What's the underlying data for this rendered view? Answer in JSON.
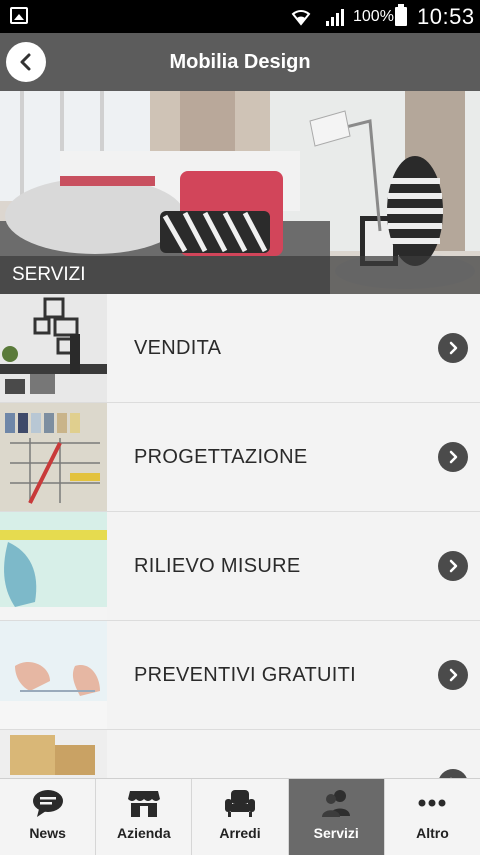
{
  "status_bar": {
    "battery": "100%",
    "time": "10:53"
  },
  "header": {
    "title": "Mobilia Design"
  },
  "hero": {
    "caption": "SERVIZI"
  },
  "services": [
    {
      "label": "VENDITA"
    },
    {
      "label": "PROGETTAZIONE"
    },
    {
      "label": "RILIEVO MISURE"
    },
    {
      "label": "PREVENTIVI GRATUITI"
    },
    {
      "label": ""
    }
  ],
  "tabs": [
    {
      "label": "News",
      "icon": "chat-bubble-icon"
    },
    {
      "label": "Azienda",
      "icon": "storefront-icon"
    },
    {
      "label": "Arredi",
      "icon": "armchair-icon"
    },
    {
      "label": "Servizi",
      "icon": "people-icon",
      "active": true
    },
    {
      "label": "Altro",
      "icon": "more-dots-icon"
    }
  ],
  "colors": {
    "header_bg": "#5c5c5c",
    "active_tab_bg": "#6a6a6a",
    "chevron_bg": "#4b4b4b"
  }
}
